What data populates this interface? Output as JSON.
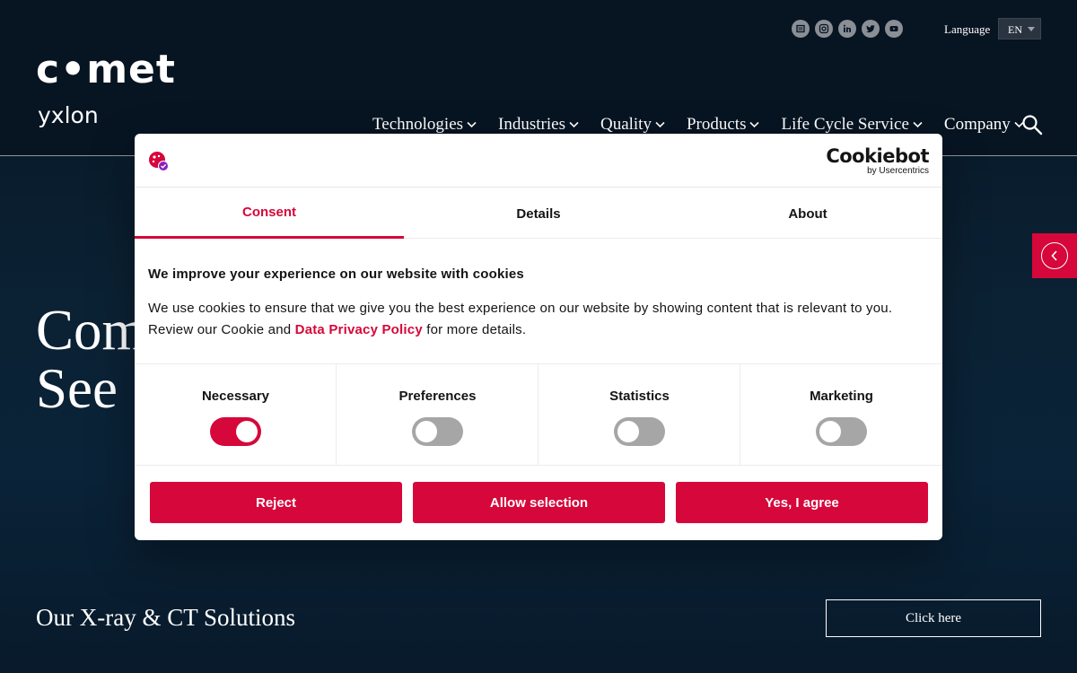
{
  "header": {
    "logo": {
      "main": "c•met",
      "sub": "yxlon"
    },
    "socials": [
      "newsletter-icon",
      "instagram-icon",
      "linkedin-icon",
      "twitter-icon",
      "youtube-icon"
    ],
    "language_label": "Language",
    "language_value": "EN",
    "nav": [
      {
        "label": "Technologies"
      },
      {
        "label": "Industries"
      },
      {
        "label": "Quality"
      },
      {
        "label": "Products"
      },
      {
        "label": "Life Cycle Service"
      },
      {
        "label": "Company"
      }
    ]
  },
  "hero": {
    "title_line1": "Com",
    "title_line2": "See",
    "solutions_label": "Our X-ray & CT Solutions",
    "cta_label": "Click here"
  },
  "cookie_dialog": {
    "brand_main": "Cookiebot",
    "brand_sub": "by Usercentrics",
    "tabs": [
      {
        "label": "Consent",
        "active": true
      },
      {
        "label": "Details",
        "active": false
      },
      {
        "label": "About",
        "active": false
      }
    ],
    "heading": "We improve your experience on our website with cookies",
    "text_before_link": "We use cookies to ensure that we give you the best experience on our website by showing content that is relevant to you. Review our Cookie and ",
    "link_label": "Data Privacy Policy",
    "text_after_link": " for more details.",
    "toggles": [
      {
        "label": "Necessary",
        "on": true
      },
      {
        "label": "Preferences",
        "on": false
      },
      {
        "label": "Statistics",
        "on": false
      },
      {
        "label": "Marketing",
        "on": false
      }
    ],
    "buttons": {
      "reject": "Reject",
      "allow_selection": "Allow selection",
      "agree": "Yes, I agree"
    }
  },
  "colors": {
    "accent": "#d6073a",
    "page_bg": "#0b2234",
    "toggle_off": "#a6a6a6"
  }
}
